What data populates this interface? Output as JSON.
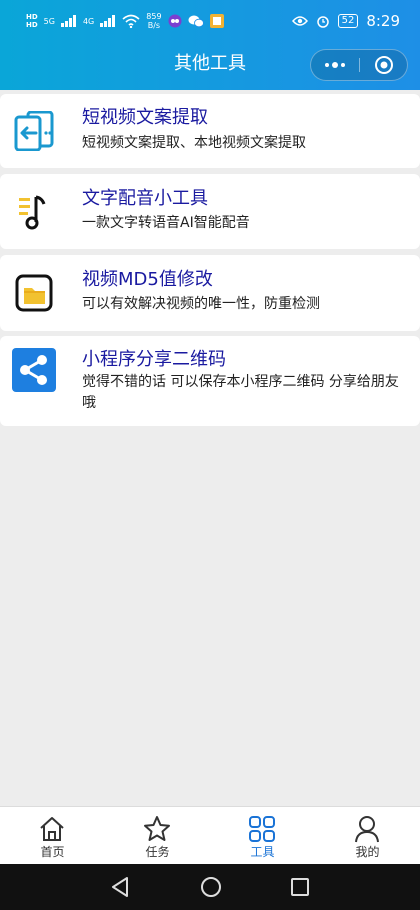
{
  "status_bar": {
    "hd_top": "HD",
    "hd_bottom": "HD",
    "net_top": "5G",
    "net_bottom": "4G",
    "speed_value": "859",
    "speed_unit": "B/s",
    "battery": "52",
    "time": "8:29"
  },
  "nav": {
    "title": "其他工具"
  },
  "tools": [
    {
      "title": "短视频文案提取",
      "subtitle": "短视频文案提取、本地视频文案提取"
    },
    {
      "title": "文字配音小工具",
      "subtitle": "一款文字转语音AI智能配音"
    },
    {
      "title": "视频MD5值修改",
      "subtitle": "可以有效解决视频的唯一性，防重检测"
    },
    {
      "title": "小程序分享二维码",
      "subtitle": "觉得不错的话 可以保存本小程序二维码 分享给朋友哦"
    }
  ],
  "tabbar": {
    "items": [
      {
        "label": "首页",
        "icon": "home-icon"
      },
      {
        "label": "任务",
        "icon": "star-icon"
      },
      {
        "label": "工具",
        "icon": "grid-icon"
      },
      {
        "label": "我的",
        "icon": "person-icon"
      }
    ],
    "active_index": 2
  },
  "colors": {
    "header_start": "#0aa6d8",
    "header_end": "#1e8fe6",
    "title_color": "#1a1aa0",
    "tab_active": "#1a73d6",
    "background": "#ededed"
  }
}
